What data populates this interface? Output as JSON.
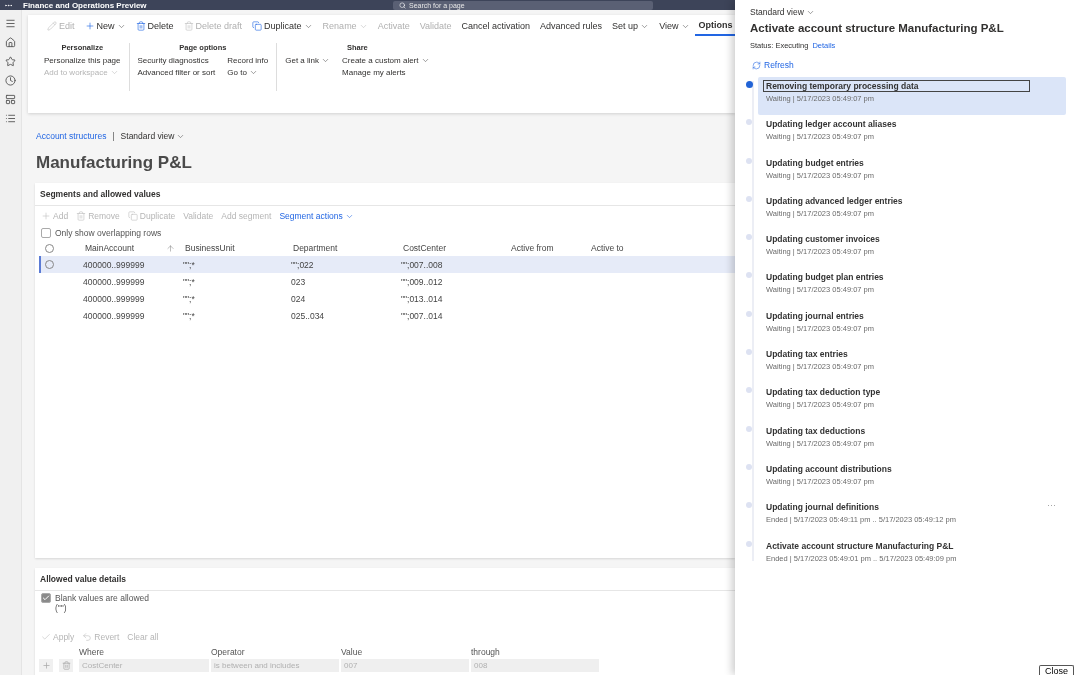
{
  "app_bar": {
    "title": "Finance and Operations Preview",
    "search_placeholder": "Search for a page"
  },
  "action_bar": {
    "actions": [
      {
        "label": "Edit",
        "kind": "edit",
        "disabled": true,
        "dropdown": false
      },
      {
        "label": "New",
        "kind": "new",
        "disabled": false,
        "dropdown": true
      },
      {
        "label": "Delete",
        "kind": "delete",
        "disabled": false,
        "dropdown": false
      },
      {
        "label": "Delete draft",
        "kind": "delete",
        "disabled": true,
        "dropdown": false
      },
      {
        "label": "Duplicate",
        "kind": "copy",
        "disabled": false,
        "dropdown": true
      },
      {
        "label": "Rename",
        "kind": "plain",
        "disabled": true,
        "dropdown": true
      },
      {
        "label": "Activate",
        "kind": "plain",
        "disabled": true,
        "dropdown": false
      },
      {
        "label": "Validate",
        "kind": "plain",
        "disabled": true,
        "dropdown": false
      },
      {
        "label": "Cancel activation",
        "kind": "plain",
        "disabled": false,
        "dropdown": false
      },
      {
        "label": "Advanced rules",
        "kind": "plain",
        "disabled": false,
        "dropdown": false
      },
      {
        "label": "Set up",
        "kind": "plain",
        "disabled": false,
        "dropdown": true
      },
      {
        "label": "View",
        "kind": "plain",
        "disabled": false,
        "dropdown": true
      }
    ],
    "tabs": [
      {
        "label": "Options",
        "selected": true
      }
    ]
  },
  "ribbon": {
    "groups": [
      {
        "title": "Personalize",
        "columns": [
          [
            {
              "label": "Personalize this page",
              "disabled": false,
              "dropdown": false
            },
            {
              "label": "Add to workspace",
              "disabled": true,
              "dropdown": true
            }
          ]
        ]
      },
      {
        "title": "Page options",
        "columns": [
          [
            {
              "label": "Security diagnostics",
              "disabled": false,
              "dropdown": false
            },
            {
              "label": "Advanced filter or sort",
              "disabled": false,
              "dropdown": false
            }
          ],
          [
            {
              "label": "Record info",
              "disabled": false,
              "dropdown": false
            },
            {
              "label": "Go to",
              "disabled": false,
              "dropdown": true
            }
          ]
        ]
      },
      {
        "title": "Share",
        "columns": [
          [
            {
              "label": "Get a link",
              "disabled": false,
              "dropdown": true
            }
          ],
          [
            {
              "label": "Create a custom alert",
              "disabled": false,
              "dropdown": true
            },
            {
              "label": "Manage my alerts",
              "disabled": false,
              "dropdown": false
            }
          ]
        ]
      }
    ]
  },
  "breadcrumb": {
    "link": "Account structures",
    "separator": "|",
    "view": "Standard view"
  },
  "page_title": "Manufacturing P&L",
  "segments": {
    "title": "Segments and allowed values",
    "toolbar": [
      {
        "label": "Add",
        "kind": "add",
        "disabled": true,
        "dropdown": false
      },
      {
        "label": "Remove",
        "kind": "delete",
        "disabled": true,
        "dropdown": false
      },
      {
        "label": "Duplicate",
        "kind": "copy",
        "disabled": true,
        "dropdown": false
      },
      {
        "label": "Validate",
        "kind": "plain",
        "disabled": true,
        "dropdown": false
      },
      {
        "label": "Add segment",
        "kind": "plain",
        "disabled": true,
        "dropdown": false
      },
      {
        "label": "Segment actions",
        "kind": "plain",
        "disabled": false,
        "dropdown": true
      }
    ],
    "filter": {
      "label": "Only show overlapping rows",
      "checked": false
    },
    "select_all": {
      "checked": false
    },
    "columns": [
      {
        "label": "MainAccount",
        "sorted": true
      },
      {
        "label": "BusinessUnit",
        "sorted": false
      },
      {
        "label": "Department",
        "sorted": false
      },
      {
        "label": "CostCenter",
        "sorted": false
      },
      {
        "label": "Active from",
        "sorted": false
      },
      {
        "label": "Active to",
        "sorted": false
      }
    ],
    "rows": [
      {
        "selected": true,
        "cells": [
          "400000..999999",
          "\"\";*",
          "\"\";022",
          "\"\";007..008"
        ]
      },
      {
        "selected": false,
        "cells": [
          "400000..999999",
          "\"\";*",
          "023",
          "\"\";009..012"
        ]
      },
      {
        "selected": false,
        "cells": [
          "400000..999999",
          "\"\";*",
          "024",
          "\"\";013..014"
        ]
      },
      {
        "selected": false,
        "cells": [
          "400000..999999",
          "\"\";*",
          "025..034",
          "\"\";007..014"
        ]
      }
    ]
  },
  "allowed_values": {
    "title": "Allowed value details",
    "blank": {
      "label": "Blank values are allowed",
      "note": "(\"\")",
      "checked": true
    },
    "toolbar": [
      {
        "label": "Apply",
        "kind": "apply",
        "disabled": true
      },
      {
        "label": "Revert",
        "kind": "revert",
        "disabled": true
      },
      {
        "label": "Clear all",
        "kind": "plain",
        "disabled": true
      }
    ],
    "columns": [
      "Where",
      "Operator",
      "Value",
      "through"
    ],
    "criteria": [
      {
        "values": [
          "CostCenter",
          "is between and includes",
          "007",
          "008"
        ]
      }
    ]
  },
  "panel": {
    "view": "Standard view",
    "title": "Activate account structure Manufacturing P&L",
    "status": "Status: Executing",
    "details_link": "Details",
    "refresh": "Refresh",
    "steps": [
      {
        "title": "Removing temporary processing data",
        "detail": "Waiting | 5/17/2023 05:49:07 pm",
        "selected": true
      },
      {
        "title": "Updating ledger account aliases",
        "detail": "Waiting | 5/17/2023 05:49:07 pm",
        "selected": false
      },
      {
        "title": "Updating budget entries",
        "detail": "Waiting | 5/17/2023 05:49:07 pm",
        "selected": false
      },
      {
        "title": "Updating advanced ledger entries",
        "detail": "Waiting | 5/17/2023 05:49:07 pm",
        "selected": false
      },
      {
        "title": "Updating customer invoices",
        "detail": "Waiting | 5/17/2023 05:49:07 pm",
        "selected": false
      },
      {
        "title": "Updating budget plan entries",
        "detail": "Waiting | 5/17/2023 05:49:07 pm",
        "selected": false
      },
      {
        "title": "Updating journal entries",
        "detail": "Waiting | 5/17/2023 05:49:07 pm",
        "selected": false
      },
      {
        "title": "Updating tax entries",
        "detail": "Waiting | 5/17/2023 05:49:07 pm",
        "selected": false
      },
      {
        "title": "Updating tax deduction type",
        "detail": "Waiting | 5/17/2023 05:49:07 pm",
        "selected": false
      },
      {
        "title": "Updating tax deductions",
        "detail": "Waiting | 5/17/2023 05:49:07 pm",
        "selected": false
      },
      {
        "title": "Updating account distributions",
        "detail": "Waiting | 5/17/2023 05:49:07 pm",
        "selected": false
      },
      {
        "title": "Updating journal definitions",
        "detail": "Ended | 5/17/2023 05:49:11 pm .. 5/17/2023 05:49:12 pm",
        "selected": false,
        "more": "···"
      },
      {
        "title": "Activate account structure Manufacturing P&L",
        "detail": "Ended | 5/17/2023 05:49:01 pm .. 5/17/2023 05:49:09 pm",
        "selected": false
      }
    ],
    "close": "Close"
  }
}
